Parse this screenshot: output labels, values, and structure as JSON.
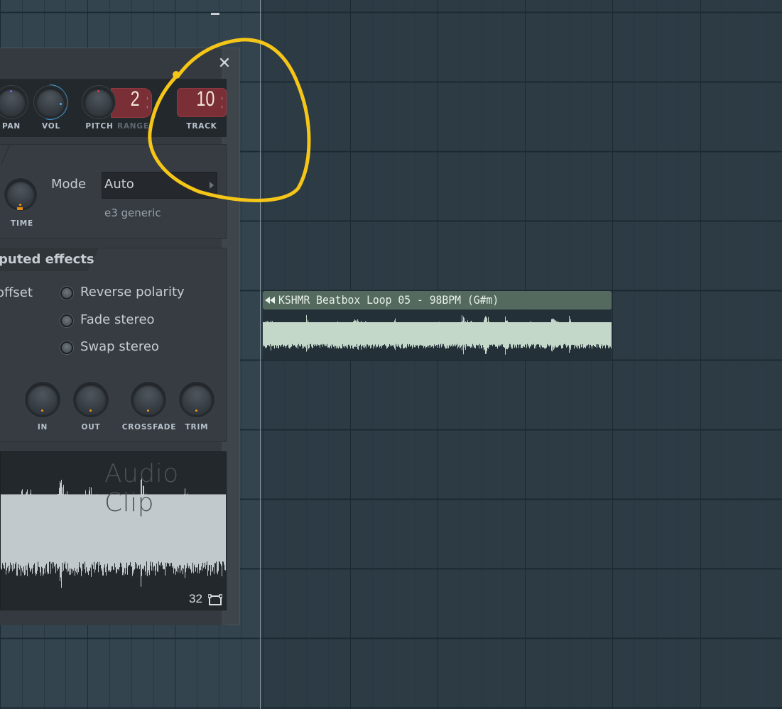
{
  "panel": {
    "title_controls": {
      "minimize": "minimize",
      "close": "close"
    },
    "knobs_top": [
      {
        "id": "pan",
        "label": "PAN"
      },
      {
        "id": "vol",
        "label": "VOL"
      },
      {
        "id": "pitch",
        "label": "PITCH"
      }
    ],
    "range": {
      "label": "RANGE",
      "value": "2"
    },
    "track": {
      "label": "TRACK",
      "value": "10"
    },
    "time_stretch": {
      "knob_label": "TIME",
      "mode_label": "Mode",
      "mode_value": "Auto",
      "mode_sub": "e3 generic"
    },
    "precomputed": {
      "tab_label": "puted effects",
      "offset_label": "offset",
      "options": [
        {
          "label": "Reverse polarity",
          "checked": false
        },
        {
          "label": "Fade stereo",
          "checked": false
        },
        {
          "label": "Swap stereo",
          "checked": false
        }
      ],
      "knobs": [
        {
          "id": "in",
          "label": "IN"
        },
        {
          "id": "out",
          "label": "OUT"
        },
        {
          "id": "crossfade",
          "label": "CROSSFADE"
        },
        {
          "id": "trim",
          "label": "TRIM"
        }
      ]
    },
    "waveform": {
      "watermark": "Audio Clip",
      "resolution": "32",
      "resolution_icon": "resize-icon"
    }
  },
  "playlist": {
    "clip": {
      "icon": "audio-clip-icon",
      "title": "KSHMR Beatbox Loop 05 - 98BPM (G#m)"
    }
  },
  "annotation": {
    "color": "#f5c518",
    "shape": "hand-drawn circle around TRACK"
  },
  "colors": {
    "vol_ring": "#3fb6ff",
    "pan_dot": "#8a5cf0",
    "pitch_dot": "#e0344b",
    "knob_dot": "#f29a1c",
    "track_box": "#7a2e36",
    "clip_header": "#546a5e",
    "waveform": "#c4d8c9"
  }
}
